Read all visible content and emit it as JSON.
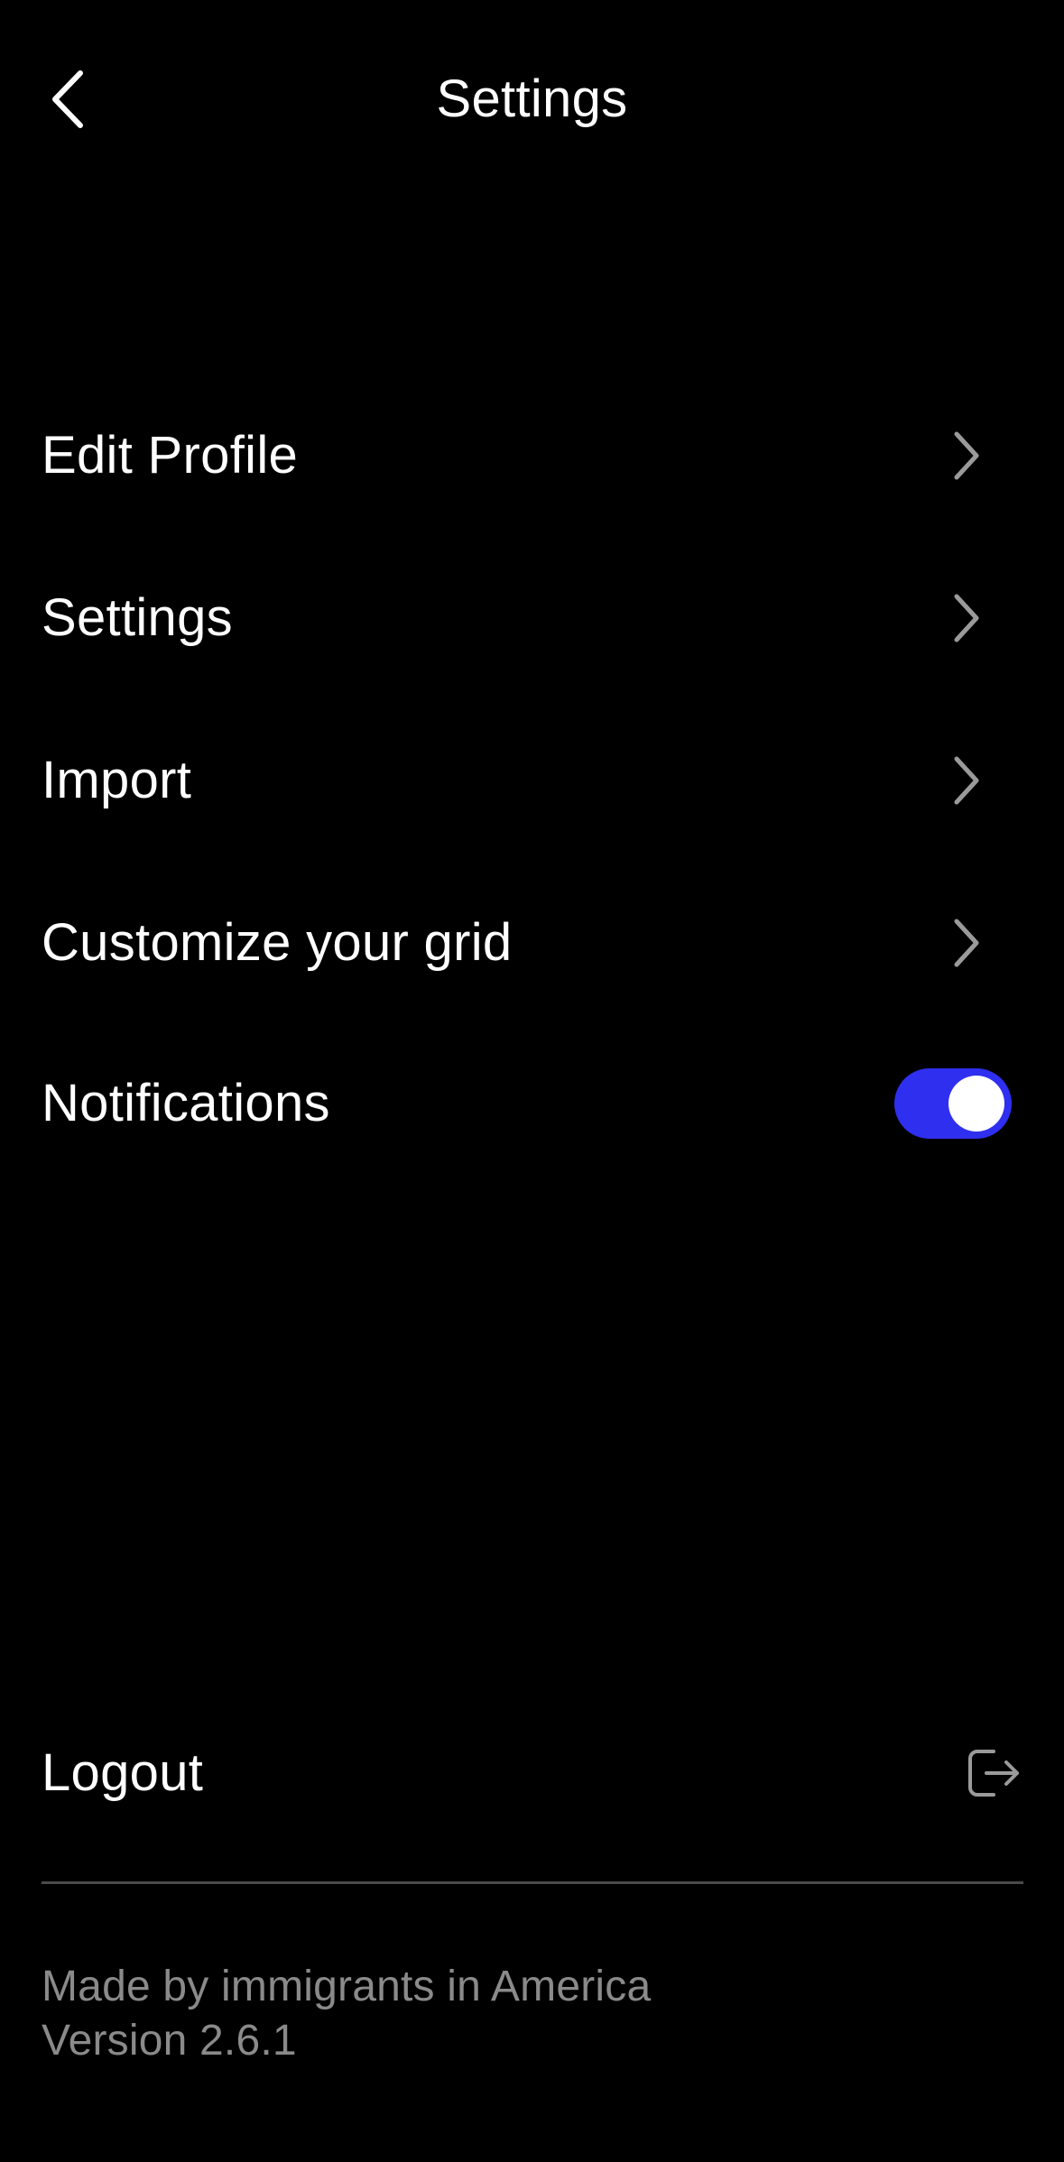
{
  "header": {
    "title": "Settings",
    "back_icon": "chevron-left-icon"
  },
  "menu": {
    "items": [
      {
        "label": "Edit Profile",
        "icon": "chevron-right-icon"
      },
      {
        "label": "Settings",
        "icon": "chevron-right-icon"
      },
      {
        "label": "Import",
        "icon": "chevron-right-icon"
      },
      {
        "label": "Customize your grid",
        "icon": "chevron-right-icon"
      }
    ],
    "notifications": {
      "label": "Notifications",
      "enabled": true
    }
  },
  "logout": {
    "label": "Logout",
    "icon": "logout-icon"
  },
  "footer": {
    "tagline": "Made by immigrants in America",
    "version": "Version 2.6.1"
  },
  "colors": {
    "background": "#000000",
    "text": "#ffffff",
    "muted": "#8a8a8a",
    "chevron": "#9a9a9a",
    "toggle_on": "#2f2ff0",
    "divider": "#4a4a4a"
  }
}
